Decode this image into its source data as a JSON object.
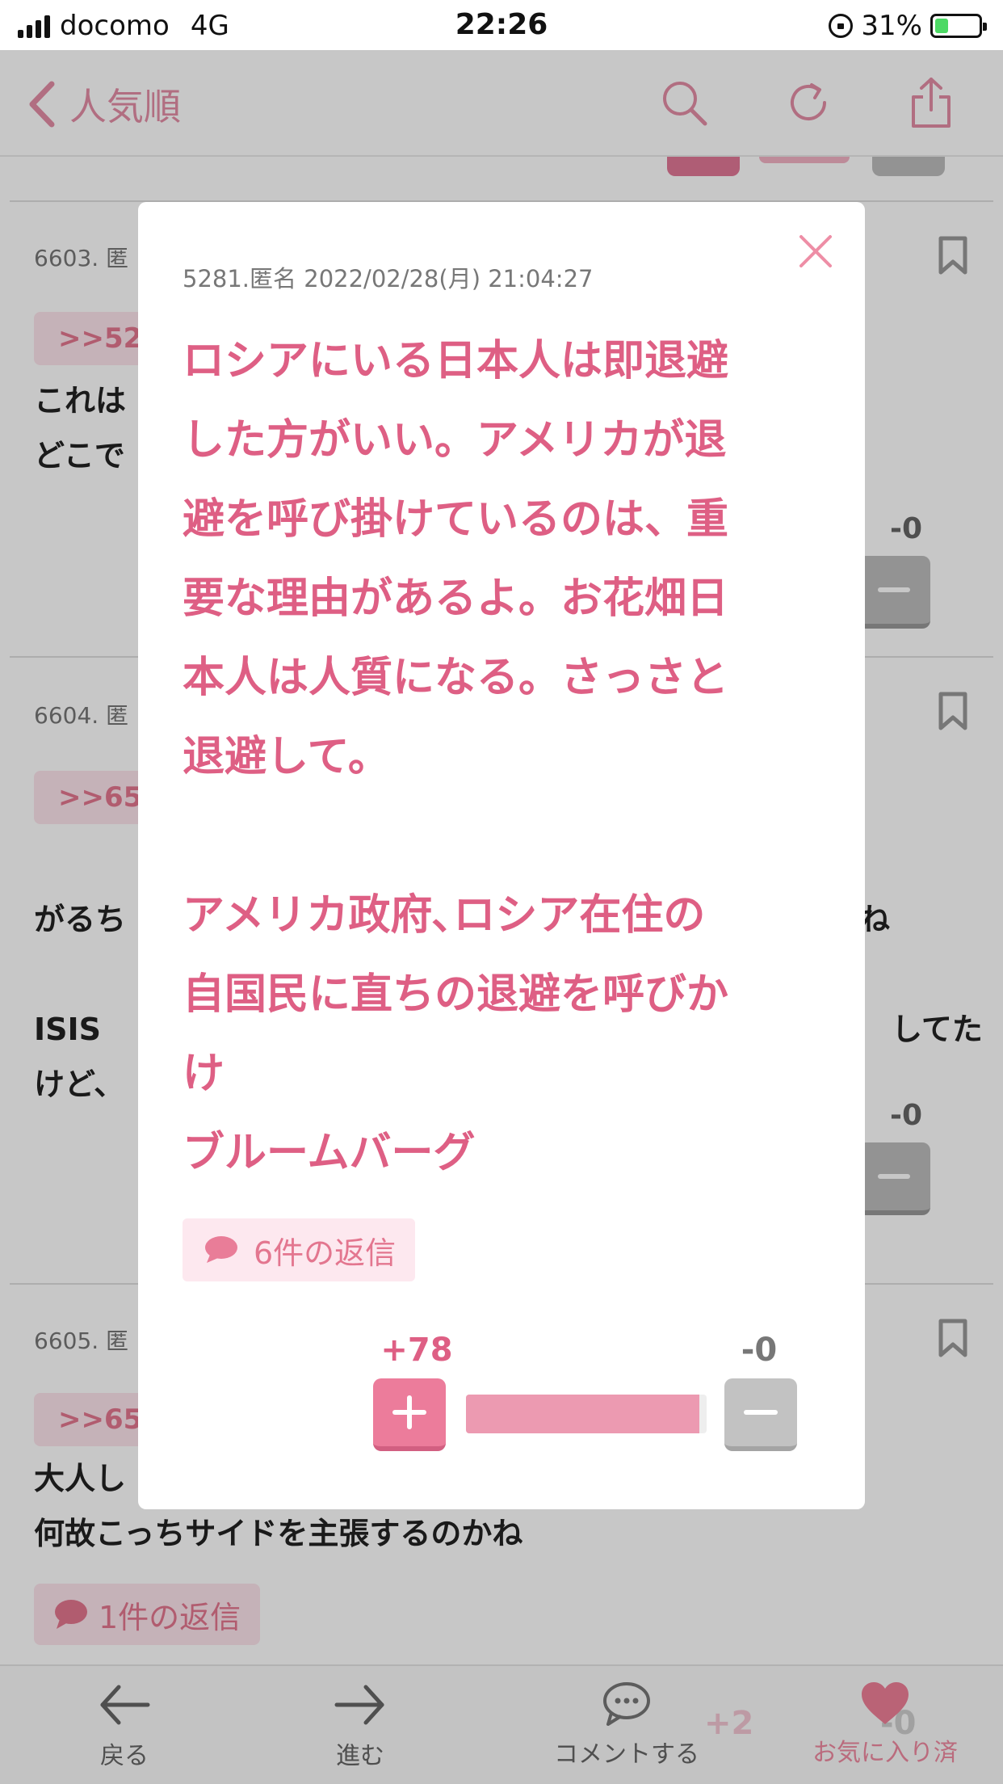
{
  "status_bar": {
    "carrier": "docomo",
    "network": "4G",
    "time": "22:26",
    "battery": "31%",
    "battery_level": 0.31,
    "charging": true
  },
  "header": {
    "title": "人気順",
    "accent": "#e38ea6"
  },
  "background_posts": [
    {
      "meta": "6603. 匿",
      "anchor": ">>52",
      "text_lines": [
        "これは",
        "どこで"
      ],
      "minus_count": "-0"
    },
    {
      "meta": "6604. 匿",
      "anchor": ">>65",
      "text_lines": [
        "がるち",
        "",
        "ISIS",
        "けど、"
      ],
      "text_right_1": "ね",
      "text_right_2": "してた",
      "minus_count": "-0"
    },
    {
      "meta": "6605. 匿",
      "anchor": ">>65",
      "text_lines": [
        "大人し",
        "何故こっちサイドを主張するのかね"
      ],
      "reply_label": "1件の返信"
    }
  ],
  "modal": {
    "meta": "5281.匿名 2022/02/28(月) 21:04:27",
    "body_lines": [
      "ロシアにいる日本人は即退避",
      "した方がいい。アメリカが退",
      "避を呼び掛けているのは、重",
      "要な理由があるよ。お花畑日",
      "本人は人質になる。さっさと",
      "退避して。",
      "",
      "アメリカ政府､ロシア在住の",
      "自国民に直ちの退避を呼びか",
      "け",
      "ブルームバーグ"
    ],
    "reply_label": "6件の返信",
    "plus_count": "+78",
    "minus_count": "-0",
    "plus_ratio": 0.97
  },
  "toolbar": {
    "back": "戻る",
    "forward": "進む",
    "comment": "コメントする",
    "favorite": "お気に入り済",
    "peek_plus": "+2",
    "peek_minus": "-0"
  }
}
